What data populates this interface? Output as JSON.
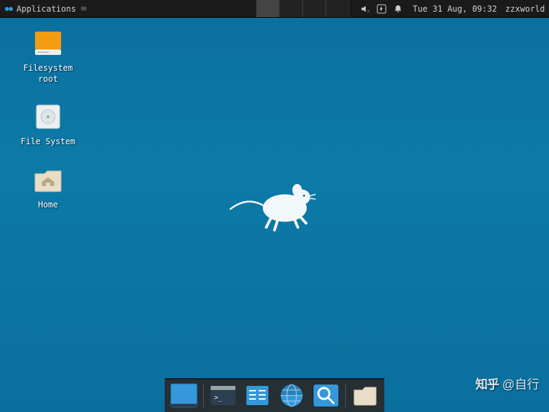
{
  "panel": {
    "app_menu_label": "Applications",
    "workspaces": 4,
    "active_workspace": 0,
    "datetime": "Tue 31 Aug, 09:32",
    "user": "zzxworld"
  },
  "desktop_icons": [
    {
      "id": "fs-root",
      "label": "Filesystem\nroot",
      "icon": "drive-orange"
    },
    {
      "id": "fs",
      "label": "File System",
      "icon": "drive-gray"
    },
    {
      "id": "home",
      "label": "Home",
      "icon": "folder-home"
    }
  ],
  "dock": [
    {
      "id": "show-desktop",
      "label": "Show Desktop",
      "icon": "show-desktop"
    },
    {
      "id": "terminal",
      "label": "Terminal",
      "icon": "terminal"
    },
    {
      "id": "files",
      "label": "File Manager",
      "icon": "files"
    },
    {
      "id": "web",
      "label": "Web Browser",
      "icon": "globe"
    },
    {
      "id": "finder",
      "label": "Application Finder",
      "icon": "finder"
    },
    {
      "id": "folder",
      "label": "Home Folder",
      "icon": "user-folder"
    }
  ],
  "watermark": {
    "site": "知乎",
    "author": "@自行"
  }
}
